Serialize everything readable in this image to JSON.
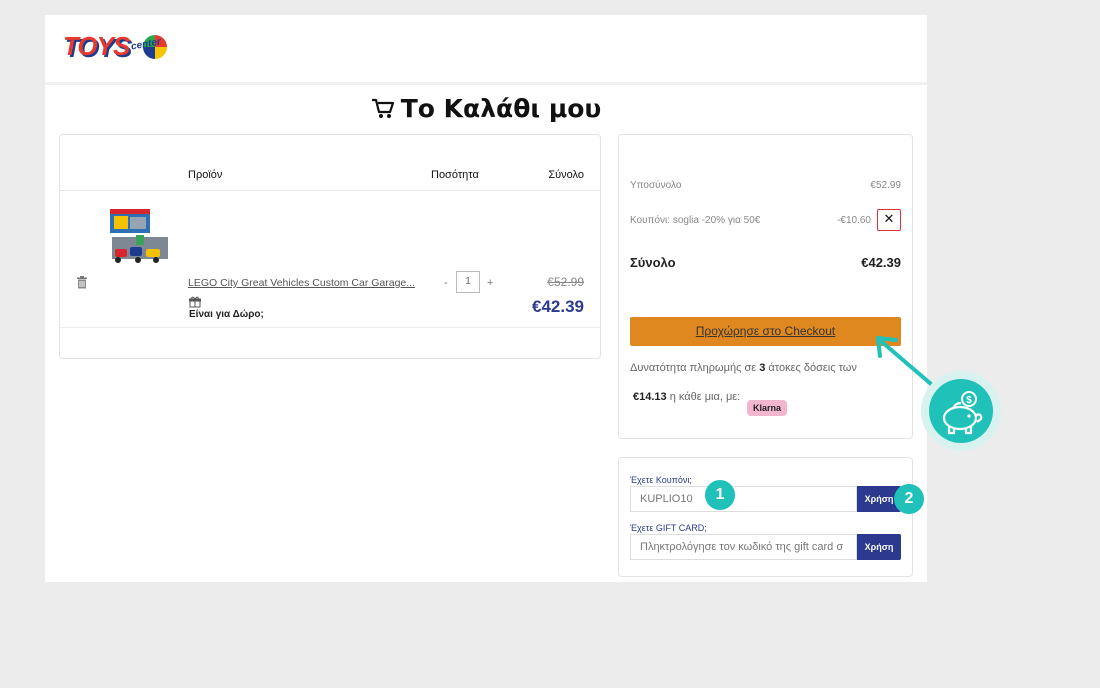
{
  "header": {
    "logo_text": "TOYS",
    "logo_sub": "center"
  },
  "page_title": "Το Καλάθι μου",
  "cart": {
    "columns": {
      "product": "Προϊόν",
      "quantity": "Ποσότητα",
      "total": "Σύνολο"
    },
    "item": {
      "name": "LEGO City Great Vehicles Custom Car Garage...",
      "gift_label": "Είναι για Δώρο;",
      "quantity": "1",
      "minus": "-",
      "plus": "+",
      "price_old": "€52.99",
      "price_new": "€42.39"
    }
  },
  "summary": {
    "subtotal_label": "Υποσύνολο",
    "subtotal_value": "€52.99",
    "coupon_label": "Κουπόνι: soglia -20% για 50€",
    "coupon_value": "-€10.60",
    "remove_label": "✕",
    "total_label": "Σύνολο",
    "total_value": "€42.39",
    "checkout_label": "Προχώρησε στο Checkout",
    "klarna_pre": "Δυνατότητα πληρωμής σε ",
    "klarna_num": "3",
    "klarna_post": " άτοκες δόσεις των",
    "installment_amount": "€14.13",
    "installment_text": " η κάθε μια, με:",
    "klarna_badge": "Klarna"
  },
  "coupon_box": {
    "coupon_label": "Έχετε Κουπόνι;",
    "coupon_value": "KUPLIO10",
    "coupon_apply": "Χρήση",
    "gift_label": "Έχετε GIFT CARD;",
    "gift_placeholder": "Πληκτρολόγησε τον κωδικό της gift card σ",
    "gift_apply": "Χρήση"
  },
  "steps": {
    "one": "1",
    "two": "2"
  },
  "colors": {
    "accent_orange": "#e08820",
    "brand_blue": "#2b3a8f",
    "teal": "#20c1b8"
  }
}
